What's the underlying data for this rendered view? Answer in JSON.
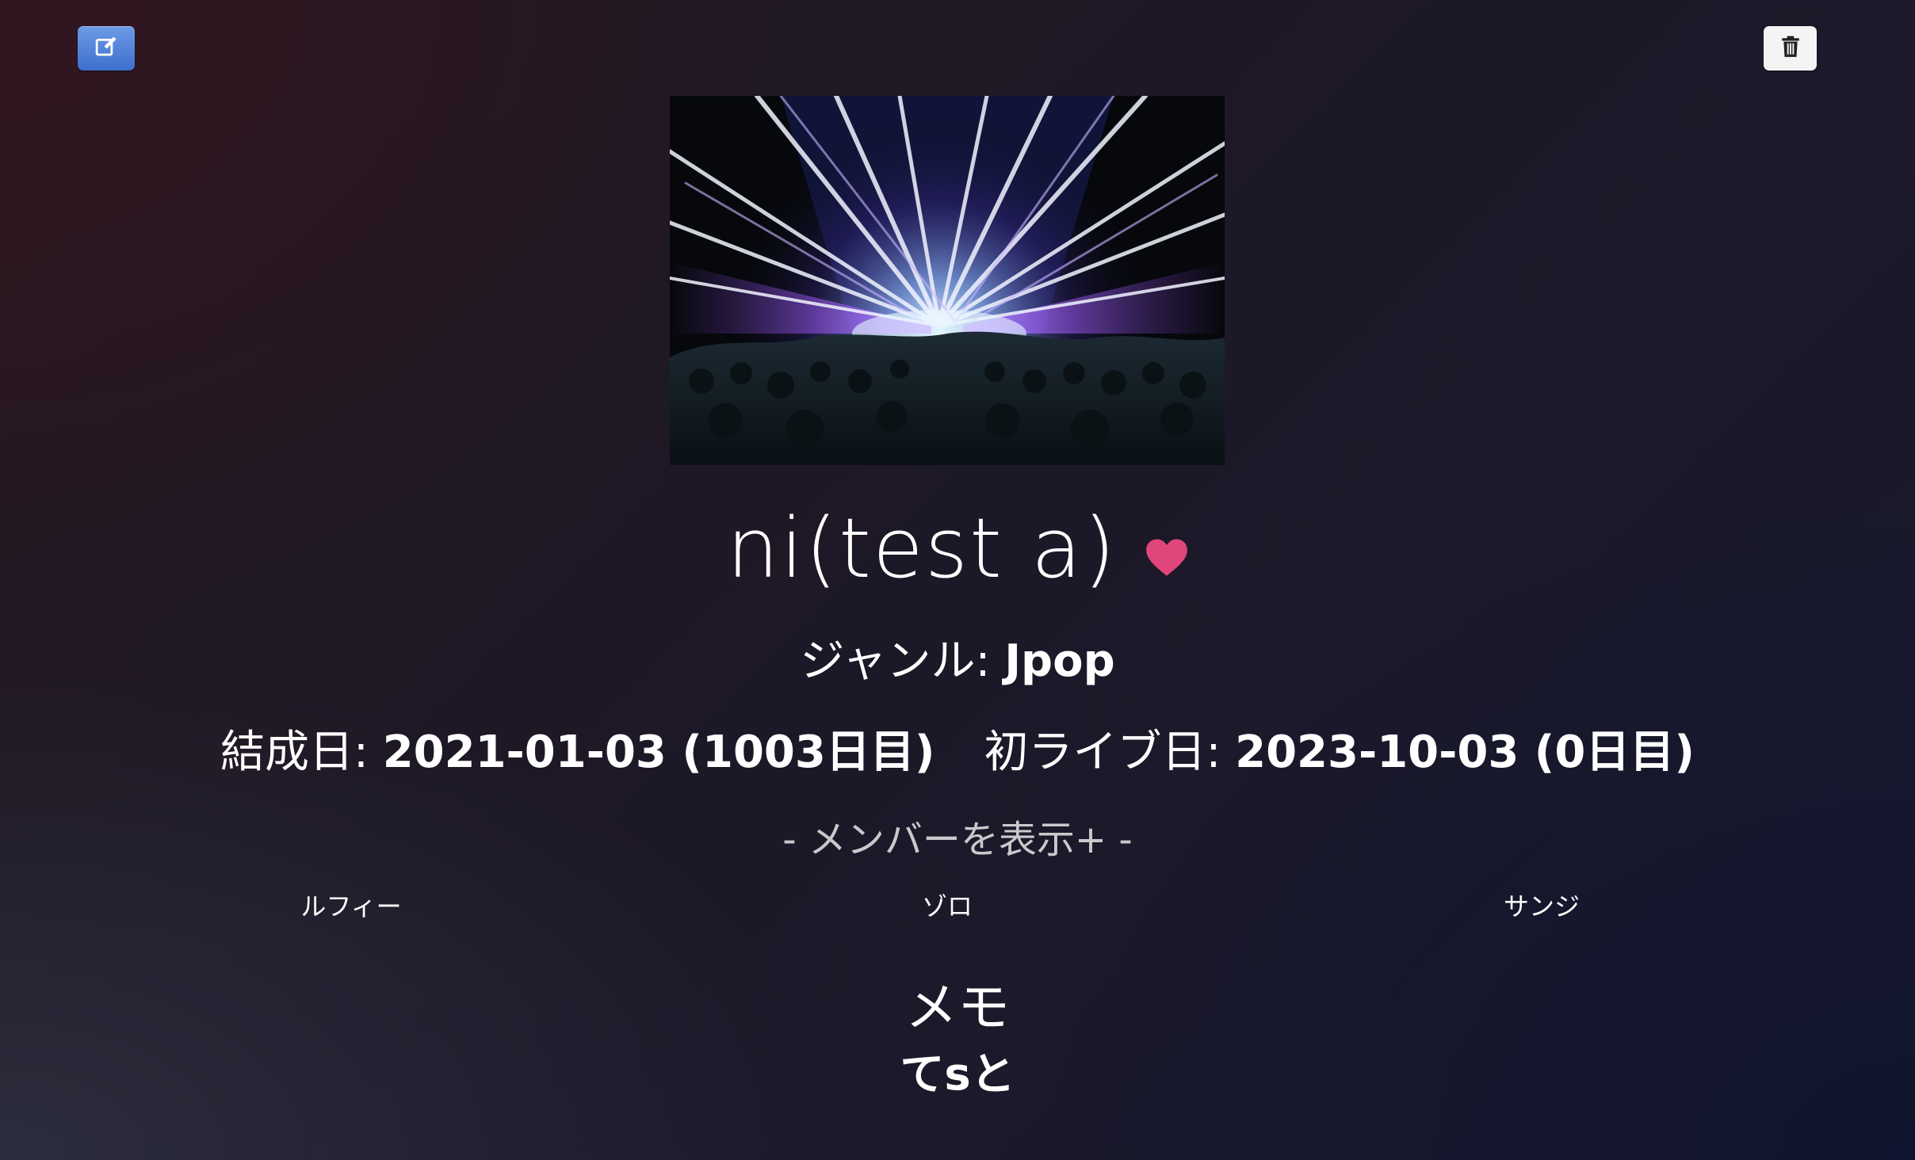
{
  "toolbar": {
    "edit_icon": "edit-icon",
    "delete_icon": "trash-icon",
    "edit_color": "#4a7bd6",
    "delete_color": "#f4f4f4"
  },
  "band": {
    "name": "ni(test a)",
    "favorite": true,
    "favorite_icon": "heart-icon",
    "favorite_color": "#e0457b",
    "cover_image": "concert-stage-lights"
  },
  "genre": {
    "label": "ジャンル: ",
    "value": "Jpop"
  },
  "dates": {
    "formed_label": "結成日: ",
    "formed_value": "2021-01-03 (1003日目)",
    "first_live_label": "初ライブ日: ",
    "first_live_value": "2023-10-03 (0日目)"
  },
  "members": {
    "toggle_label": "- メンバーを表示+ -",
    "names": [
      "ルフィー",
      "ゾロ",
      "サンジ"
    ]
  },
  "memo": {
    "title": "メモ",
    "text": "てsと"
  }
}
